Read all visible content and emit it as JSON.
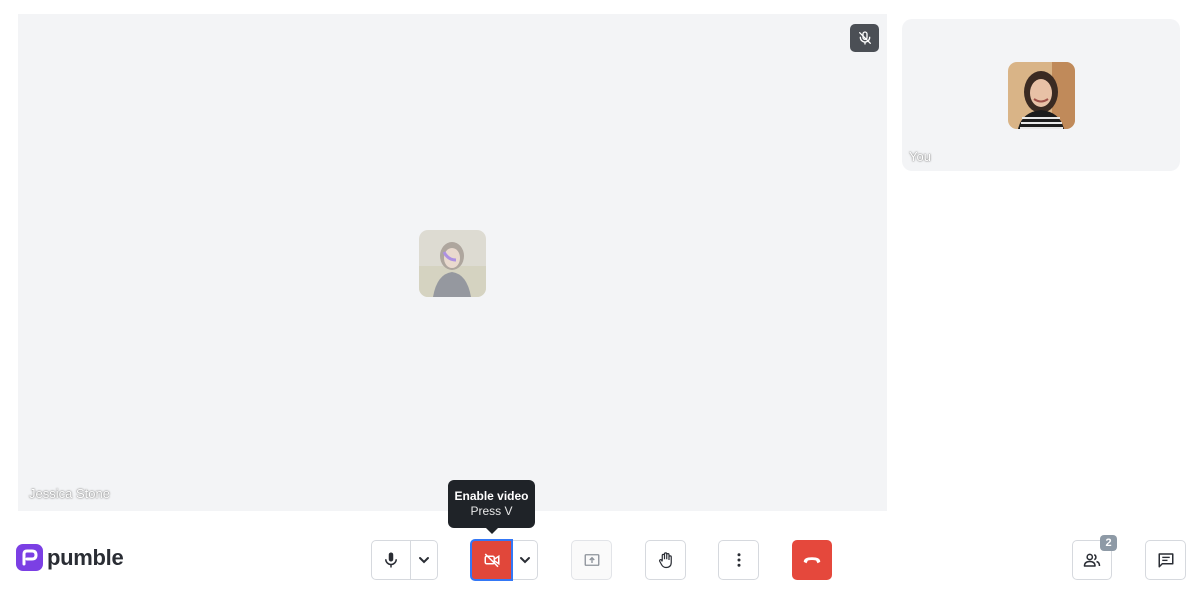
{
  "stage": {
    "participant_name": "Jessica Stone",
    "mute_icon": "mic-off-icon"
  },
  "self_tile": {
    "label": "You"
  },
  "brand": {
    "name": "pumble",
    "accent": "#7b3fe4"
  },
  "toolbar": {
    "mic_icon": "microphone-icon",
    "mic_options_icon": "chevron-down-icon",
    "video_icon": "video-off-icon",
    "video_options_icon": "chevron-down-icon",
    "share_icon": "screen-share-icon",
    "raise_hand_icon": "hand-icon",
    "more_icon": "more-vertical-icon",
    "hangup_icon": "phone-hangup-icon",
    "participants_icon": "people-icon",
    "chat_icon": "chat-icon"
  },
  "tooltip": {
    "title": "Enable video",
    "shortcut": "Press V"
  },
  "participants": {
    "count": "2"
  },
  "colors": {
    "video_off": "#e1473a",
    "hangup": "#e5483c",
    "focus_ring": "#3478f6"
  }
}
